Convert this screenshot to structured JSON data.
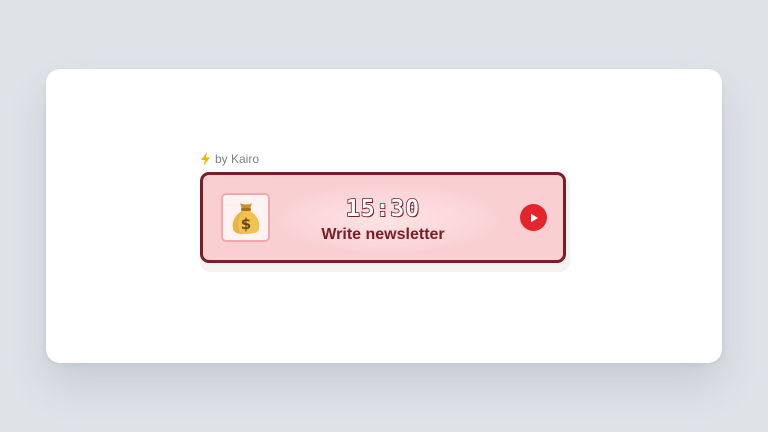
{
  "byline": {
    "icon": "lightning-bolt-icon",
    "text": "by Kairo"
  },
  "timer_widget": {
    "task_icon": "money-bag-icon",
    "time": "15:30",
    "task": "Write newsletter",
    "play_icon": "play-icon",
    "colors": {
      "background": "#f9cfd1",
      "border": "#7b1d27",
      "text": "#7b1d27",
      "play_button": "#e4262c",
      "bolt": "#f2b705"
    }
  }
}
